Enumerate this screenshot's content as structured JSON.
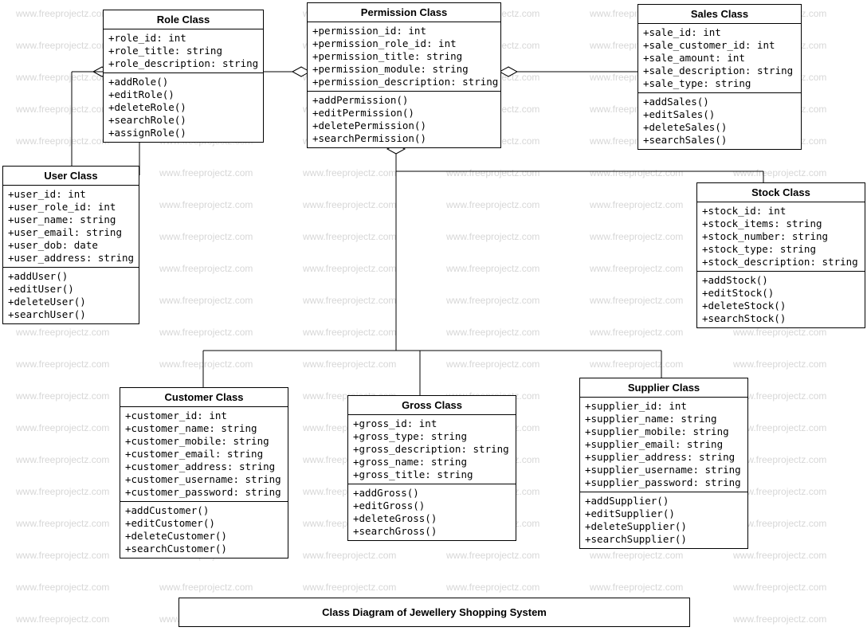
{
  "title": "Class Diagram of Jewellery Shopping System",
  "watermark_text": "www.freeprojectz.com",
  "classes": {
    "role": {
      "name": "Role Class",
      "attrs": [
        "+role_id: int",
        "+role_title: string",
        "+role_description: string"
      ],
      "ops": [
        "+addRole()",
        "+editRole()",
        "+deleteRole()",
        "+searchRole()",
        "+assignRole()"
      ]
    },
    "permission": {
      "name": "Permission Class",
      "attrs": [
        "+permission_id: int",
        "+permission_role_id: int",
        "+permission_title: string",
        "+permission_module: string",
        "+permission_description: string"
      ],
      "ops": [
        "+addPermission()",
        "+editPermission()",
        "+deletePermission()",
        "+searchPermission()"
      ]
    },
    "sales": {
      "name": "Sales Class",
      "attrs": [
        "+sale_id: int",
        "+sale_customer_id: int",
        "+sale_amount: int",
        "+sale_description: string",
        "+sale_type: string"
      ],
      "ops": [
        "+addSales()",
        "+editSales()",
        "+deleteSales()",
        "+searchSales()"
      ]
    },
    "user": {
      "name": "User Class",
      "attrs": [
        "+user_id: int",
        "+user_role_id: int",
        "+user_name: string",
        "+user_email: string",
        "+user_dob: date",
        "+user_address: string"
      ],
      "ops": [
        "+addUser()",
        "+editUser()",
        "+deleteUser()",
        "+searchUser()"
      ]
    },
    "stock": {
      "name": "Stock Class",
      "attrs": [
        "+stock_id: int",
        "+stock_items: string",
        "+stock_number: string",
        "+stock_type: string",
        "+stock_description: string"
      ],
      "ops": [
        "+addStock()",
        "+editStock()",
        "+deleteStock()",
        "+searchStock()"
      ]
    },
    "customer": {
      "name": "Customer Class",
      "attrs": [
        "+customer_id: int",
        "+customer_name: string",
        "+customer_mobile: string",
        "+customer_email: string",
        "+customer_address: string",
        "+customer_username: string",
        "+customer_password: string"
      ],
      "ops": [
        "+addCustomer()",
        "+editCustomer()",
        "+deleteCustomer()",
        "+searchCustomer()"
      ]
    },
    "gross": {
      "name": "Gross Class",
      "attrs": [
        "+gross_id: int",
        "+gross_type: string",
        "+gross_description: string",
        "+gross_name: string",
        "+gross_title: string"
      ],
      "ops": [
        "+addGross()",
        "+editGross()",
        "+deleteGross()",
        "+searchGross()"
      ]
    },
    "supplier": {
      "name": "Supplier Class",
      "attrs": [
        "+supplier_id: int",
        "+supplier_name: string",
        "+supplier_mobile: string",
        "+supplier_email: string",
        "+supplier_address: string",
        "+supplier_username: string",
        "+supplier_password: string"
      ],
      "ops": [
        "+addSupplier()",
        "+editSupplier()",
        "+deleteSupplier()",
        "+searchSupplier()"
      ]
    }
  }
}
